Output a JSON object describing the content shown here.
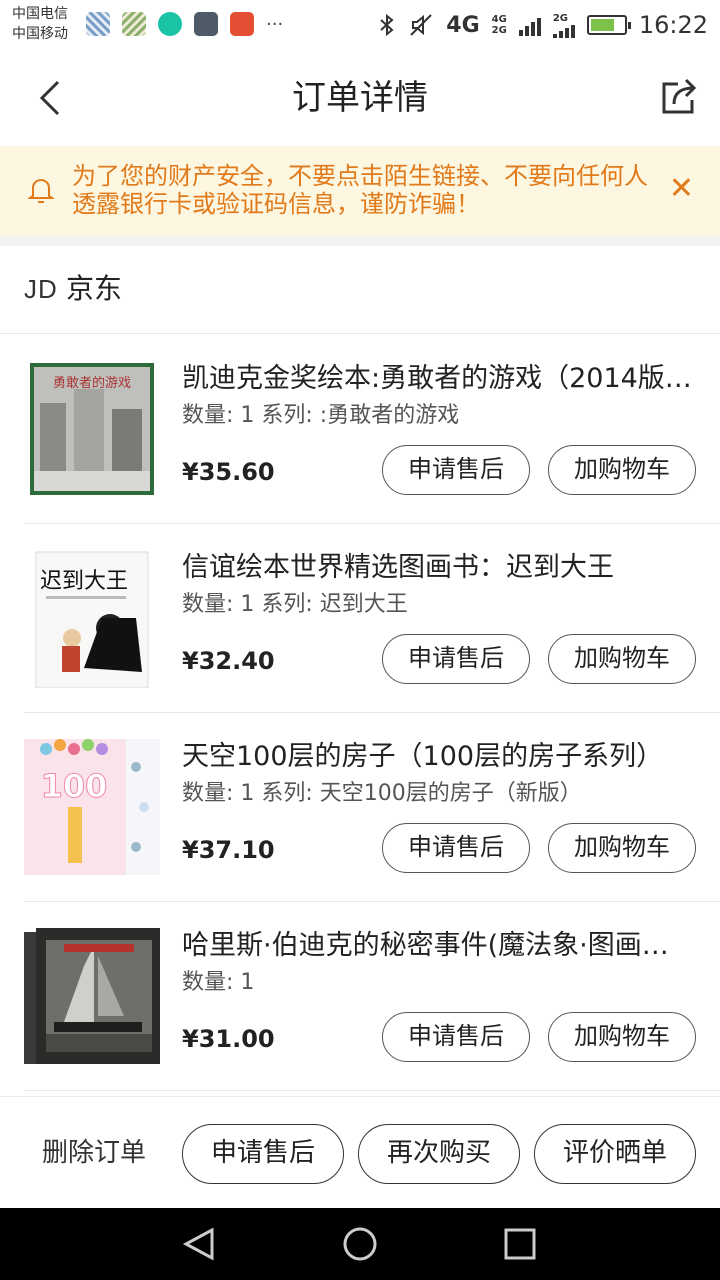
{
  "status_bar": {
    "carrier_1": "中国电信",
    "carrier_2": "中国移动",
    "more": "···",
    "network_4g": "4G",
    "net_small_1": "4G",
    "net_small_2": "2G",
    "net_small_3": "2G",
    "time": "16:22"
  },
  "header": {
    "title": "订单详情"
  },
  "warning": {
    "text": "为了您的财产安全，不要点击陌生链接、不要向任何人透露银行卡或验证码信息，谨防诈骗！"
  },
  "shop": {
    "logo_text": "JD",
    "name": "京东"
  },
  "items": [
    {
      "title": "凯迪克金奖绘本:勇敢者的游戏（2014版…",
      "meta": "数量: 1 系列: :勇敢者的游戏",
      "price": "¥35.60",
      "cover_text": "勇敢者的游戏",
      "after_sale_label": "申请售后",
      "add_cart_label": "加购物车"
    },
    {
      "title": "信谊绘本世界精选图画书：迟到大王",
      "meta": "数量: 1 系列: 迟到大王",
      "price": "¥32.40",
      "cover_text": "迟到大王",
      "after_sale_label": "申请售后",
      "add_cart_label": "加购物车"
    },
    {
      "title": "天空100层的房子（100层的房子系列）",
      "meta": "数量: 1 系列: 天空100层的房子（新版）",
      "price": "¥37.10",
      "cover_text": "100",
      "after_sale_label": "申请售后",
      "add_cart_label": "加购物车"
    },
    {
      "title": "哈里斯·伯迪克的秘密事件(魔法象·图画…",
      "meta": "数量: 1",
      "price": "¥31.00",
      "cover_text": "",
      "after_sale_label": "申请售后",
      "add_cart_label": "加购物车"
    }
  ],
  "bottom_bar": {
    "delete_label": "删除订单",
    "after_sale_label": "申请售后",
    "buy_again_label": "再次购买",
    "review_label": "评价晒单"
  },
  "colors": {
    "warning_bg": "#fdf6e0",
    "warning_text": "#e07a1a"
  }
}
